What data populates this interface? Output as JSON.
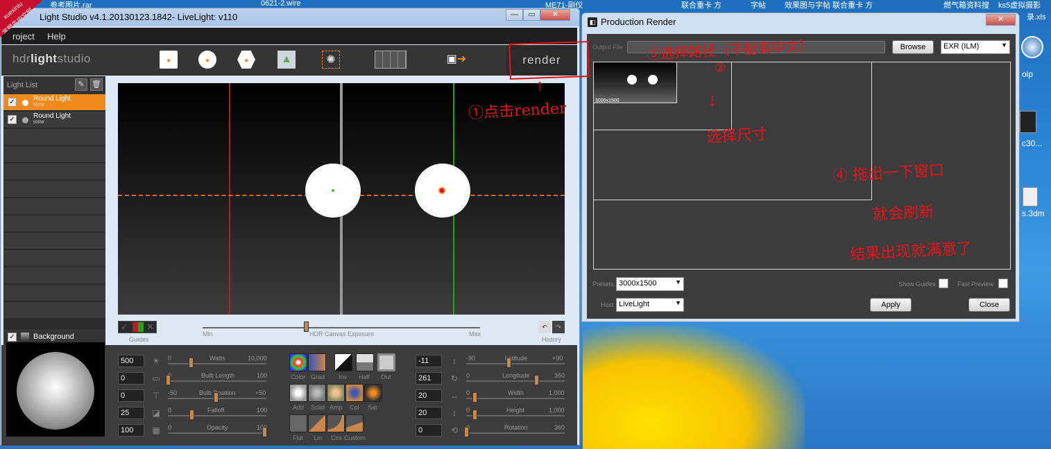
{
  "taskbar_files": [
    "参考图片.rar",
    "0621-2.wire",
    "ME71-副仪",
    "联合重卡 方",
    "字帖",
    "效果图与字帖 联合重卡 方",
    "燃气箱资料搜",
    "ks5虚拟摄影",
    "录.xls"
  ],
  "watermark": {
    "line1": "xuexiniu",
    "line2": "学犀牛中文网"
  },
  "hdr_window": {
    "title": "Light Studio v4.1.20130123.1842- LiveLight: v110",
    "menu": [
      "roject",
      "Help"
    ],
    "brand_light": "hdr",
    "brand_bold": "light",
    "brand_rest": "studio",
    "render_label": "render",
    "light_list_title": "Light List",
    "lights": [
      {
        "name": "Round Light",
        "sub": "500W",
        "selected": true
      },
      {
        "name": "Round Light",
        "sub": "500W",
        "selected": false
      }
    ],
    "background_label": "Background",
    "guides_label": "Guides",
    "history_label": "History",
    "exposure": {
      "min": "Min",
      "label": "HDR Canvas Exposure",
      "max": "Max"
    },
    "left_params": [
      {
        "value": "500",
        "name": "Watts",
        "min": "0",
        "max": "10,000"
      },
      {
        "value": "0",
        "name": "Bulb Length",
        "min": "0",
        "max": "100"
      },
      {
        "value": "0",
        "name": "Bulb Position",
        "min": "-50",
        "max": "+50"
      },
      {
        "value": "25",
        "name": "Falloff",
        "min": "0",
        "max": "100"
      },
      {
        "value": "100",
        "name": "Opacity",
        "min": "0",
        "max": "100"
      }
    ],
    "right_params": [
      {
        "value": "-11",
        "name": "Latitude",
        "min": "-90",
        "max": "+90"
      },
      {
        "value": "261",
        "name": "Longitude",
        "min": "0",
        "max": "360"
      },
      {
        "value": "20",
        "name": "Width",
        "min": "0",
        "max": "1,000"
      },
      {
        "value": "20",
        "name": "Height",
        "min": "0",
        "max": "1,000"
      },
      {
        "value": "0",
        "name": "Rotation",
        "min": "0",
        "max": "360"
      }
    ],
    "tool_row1": [
      "Color",
      "Grad",
      "Inv",
      "Half",
      "Out"
    ],
    "tool_row2": [
      "Add",
      "Solid",
      "Amp",
      "Col",
      "Sat"
    ],
    "tool_row3": [
      "Flat",
      "Lin",
      "Cos",
      "Custom"
    ]
  },
  "render_window": {
    "title": "Production Render",
    "output_label": "Output File",
    "browse": "Browse",
    "format": "EXR (ILM)",
    "thumb_size": "3000x1500",
    "presets_label": "Presets",
    "preset_value": "3000x1500",
    "host_label": "Host",
    "host_value": "LiveLight",
    "show_guides": "Show Guides",
    "fast_preview": "Fast Preview",
    "apply": "Apply",
    "close": "Close"
  },
  "desktop_icons": [
    "oip",
    "c30...",
    "s.3dm"
  ],
  "annotations": {
    "a1": "①点击render",
    "a2": "③选择路径（不能有中文）",
    "a3": "②",
    "a4": "选择尺寸",
    "a5": "④ 拖出一下窗口",
    "a6": "就会刷新",
    "a7": "结果出现就满意了"
  }
}
